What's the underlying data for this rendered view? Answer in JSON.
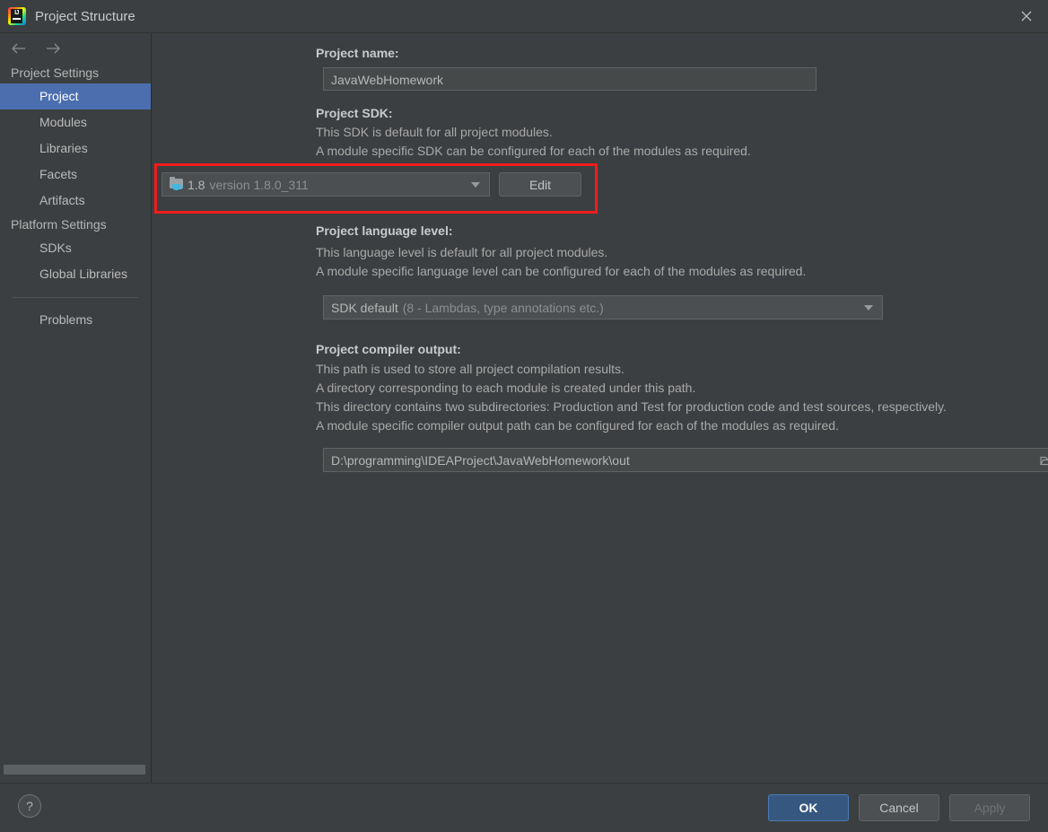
{
  "window": {
    "title": "Project Structure",
    "app_icon": "intellij-idea-logo",
    "close_icon": "close-icon"
  },
  "sidebar": {
    "back_icon": "arrow-left-icon",
    "forward_icon": "arrow-right-icon",
    "groups": [
      {
        "label": "Project Settings",
        "items": [
          {
            "label": "Project",
            "selected": true
          },
          {
            "label": "Modules",
            "selected": false
          },
          {
            "label": "Libraries",
            "selected": false
          },
          {
            "label": "Facets",
            "selected": false
          },
          {
            "label": "Artifacts",
            "selected": false
          }
        ]
      },
      {
        "label": "Platform Settings",
        "items": [
          {
            "label": "SDKs",
            "selected": false
          },
          {
            "label": "Global Libraries",
            "selected": false
          }
        ]
      }
    ],
    "problems_label": "Problems"
  },
  "main": {
    "project_name": {
      "label": "Project name:",
      "value": "JavaWebHomework"
    },
    "project_sdk": {
      "label": "Project SDK:",
      "desc_line_1": "This SDK is default for all project modules.",
      "desc_line_2": "A module specific SDK can be configured for each of the modules as required.",
      "icon": "java-sdk-folder-icon",
      "value_name": "1.8",
      "value_version": "version 1.8.0_311",
      "edit_label": "Edit",
      "highlight_color": "#f01c1c"
    },
    "language_level": {
      "label": "Project language level:",
      "desc_line_1": "This language level is default for all project modules.",
      "desc_line_2": "A module specific language level can be configured for each of the modules as required.",
      "value_name": "SDK default",
      "value_detail": "(8 - Lambdas, type annotations etc.)"
    },
    "compiler_output": {
      "label": "Project compiler output:",
      "desc_line_1": "This path is used to store all project compilation results.",
      "desc_line_2": "A directory corresponding to each module is created under this path.",
      "desc_line_3": "This directory contains two subdirectories: Production and Test for production code and test sources, respectively.",
      "desc_line_4": "A module specific compiler output path can be configured for each of the modules as required.",
      "value": "D:\\programming\\IDEAProject\\JavaWebHomework\\out",
      "browse_icon": "folder-browse-icon"
    }
  },
  "footer": {
    "help_label": "?",
    "ok_label": "OK",
    "cancel_label": "Cancel",
    "apply_label": "Apply",
    "primary_color": "#365880"
  }
}
